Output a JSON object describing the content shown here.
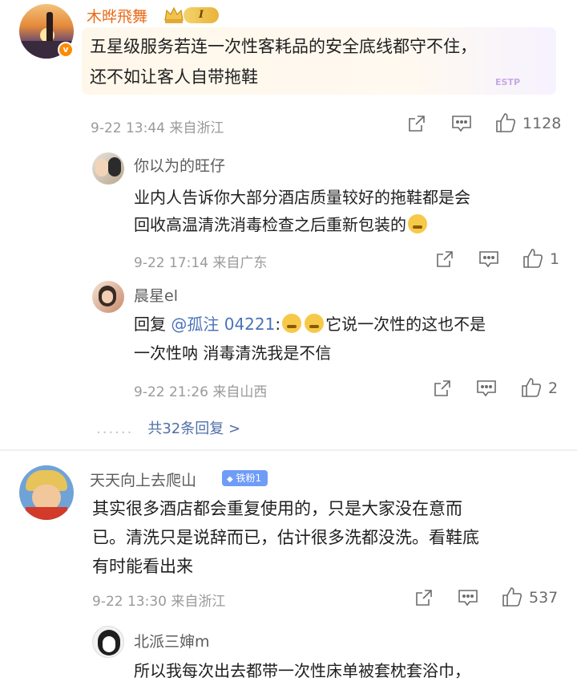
{
  "comments": [
    {
      "name": "木晔飛舞",
      "level": "I",
      "verified_mark": "v",
      "text_line1": "五星级服务若连一次性客耗品的安全底线都守不住，",
      "text_line2": "还不如让客人自带拖鞋",
      "sticker_text": "ESTP",
      "meta": "9-22 13:44 来自浙江",
      "likes": "1128",
      "replies": [
        {
          "name": "你以为的旺仔",
          "text_line1": "业内人告诉你大部分酒店质量较好的拖鞋都是会",
          "text_line2": "回收高温清洗消毒检查之后重新包装的",
          "meta": "9-22 17:14 来自广东",
          "likes": "1"
        },
        {
          "name": "晨星el",
          "text_prefix": "回复 ",
          "mention": "@孤注 04221",
          "text_rest": ":",
          "text_after": "它说一次性的这也不是",
          "text_line2": "一次性呐 消毒清洗我是不信",
          "meta": "9-22 21:26 来自山西",
          "likes": "2"
        }
      ],
      "more_dots": "......",
      "more_label": "共32条回复 >"
    },
    {
      "name": "天天向上去爬山",
      "fan_badge": "铁粉1",
      "text_line1": "其实很多酒店都会重复使用的，只是大家没在意而",
      "text_line2": "已。清洗只是说辞而已，估计很多洗都没洗。看鞋底",
      "text_line3": "有时能看出来",
      "meta": "9-22 13:30 来自浙江",
      "likes": "537",
      "replies": [
        {
          "name": "北派三婶m",
          "text_line1": "所以我每次出去都带一次性床单被套枕套浴巾，"
        }
      ]
    }
  ],
  "icons": {
    "share": "share-icon",
    "comment": "comment-icon",
    "like": "like-icon",
    "crown": "crown-icon",
    "diamond": "diamond-icon"
  },
  "colors": {
    "name_orange": "#eb6a17",
    "link_blue": "#4f6fa8",
    "meta_gray": "#9a9a9a",
    "fan_badge": "#6f9cf7"
  }
}
